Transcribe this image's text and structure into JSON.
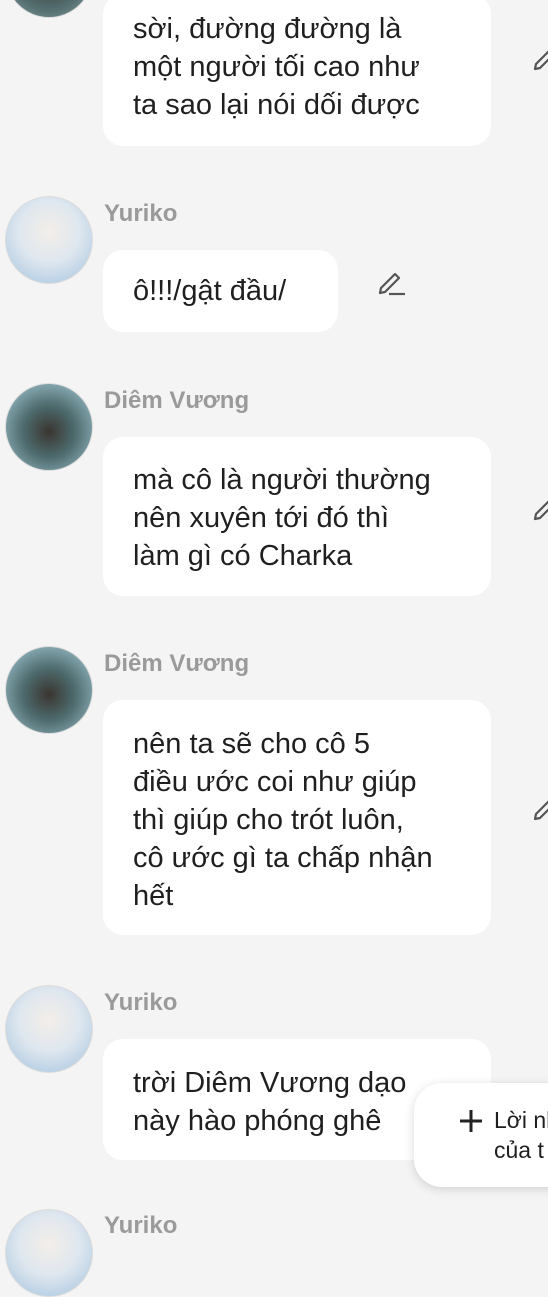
{
  "messages": [
    {
      "sender": "",
      "lines": [
        "sời, đường đường là",
        "một người tối cao như",
        "ta sao lại nói dối được"
      ]
    },
    {
      "sender": "Yuriko",
      "lines": [
        "ô!!!/gật đầu/"
      ]
    },
    {
      "sender": "Diêm Vương",
      "lines": [
        "mà cô là người thường",
        "nên xuyên tới đó thì",
        "làm gì có  Charka"
      ]
    },
    {
      "sender": "Diêm Vương",
      "lines": [
        "nên ta sẽ cho cô 5",
        "điều ước coi như giúp",
        "thì giúp cho trót luôn,",
        "cô ước gì ta chấp nhận",
        "hết"
      ]
    },
    {
      "sender": "Yuriko",
      "lines": [
        "trời Diêm Vương dạo",
        "này hào phóng ghê"
      ]
    },
    {
      "sender": "Yuriko",
      "lines": []
    }
  ],
  "fab": {
    "line1": "Lời nh",
    "line2": "của t"
  },
  "colors": {
    "background": "#f4f4f5",
    "bubble": "#ffffff",
    "sender": "#9a9a9a",
    "icon": "#555555"
  },
  "icons": [
    "edit-pencil-icon",
    "plus-icon"
  ]
}
